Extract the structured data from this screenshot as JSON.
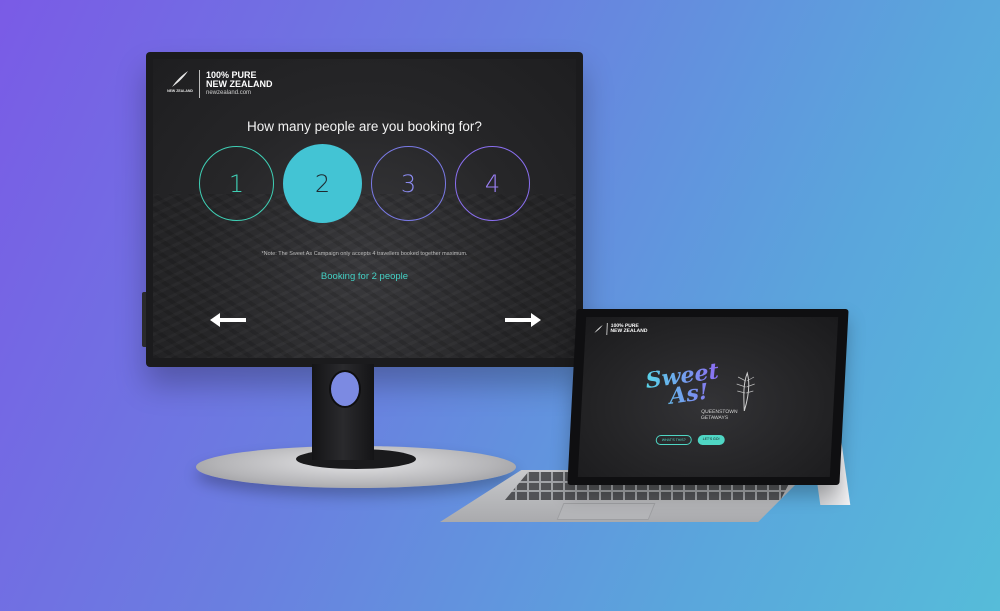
{
  "monitor": {
    "brand": {
      "fern_caption": "NEW ZEALAND",
      "line1": "100% PURE",
      "line2": "NEW ZEALAND",
      "url": "newzealand.com"
    },
    "question": "How many people are you booking for?",
    "options": [
      "1",
      "2",
      "3",
      "4"
    ],
    "selected_option": "2",
    "note": "*Note: The Sweet As Campaign only accepts 4 travellers booked together maximum.",
    "booking_status": "Booking for 2 people",
    "nav": {
      "back_icon": "arrow-left-icon",
      "next_icon": "arrow-right-icon"
    },
    "colors": {
      "teal": "#3fcfb5",
      "selected_fill": "#43c4d4",
      "purple": "#8a6ff0"
    }
  },
  "tablet": {
    "brand": {
      "line1": "100% PURE",
      "line2": "NEW ZEALAND"
    },
    "logo_word1": "Sweet",
    "logo_word2": "As!",
    "subtitle_line1": "QUEENSTOWN",
    "subtitle_line2": "GETAWAYS",
    "button_outline": "WHAT'S THIS?",
    "button_fill": "LET'S GO!"
  }
}
